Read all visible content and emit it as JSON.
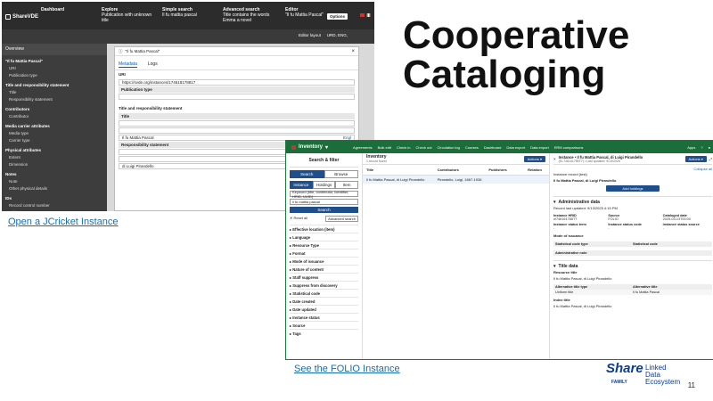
{
  "slide": {
    "title_line1": "Cooperative",
    "title_line2": "Cataloging",
    "link_jcricket": "Open a JCricket Instance",
    "link_folio": "See the FOLIO Instance",
    "page_number": "11",
    "logo": {
      "share": "Share",
      "family": "FAMILY",
      "line1": "Linked",
      "line2": "Data",
      "line3": "Ecosystem"
    }
  },
  "sharevde": {
    "app_name": "ShareVDE",
    "nav": [
      {
        "title": "Dashboard",
        "subtitle": ""
      },
      {
        "title": "Explore",
        "subtitle": "Publication with unknown title"
      },
      {
        "title": "Simple search",
        "subtitle": "Il fu mattia pascal"
      },
      {
        "title": "Advanced search",
        "subtitle": "Title contains the words Emma a novel"
      },
      {
        "title": "Editor",
        "subtitle": "\"Il fu Mattia Pascal\""
      }
    ],
    "options_label": "Options",
    "editor_layout": "Editor layout",
    "language": "URD, ENG,",
    "overview_label": "Overview",
    "overview_record": "\"Il fu Mattia Pascal\"",
    "sidebar": [
      {
        "label": "URI",
        "type": "sub"
      },
      {
        "label": "Publication type",
        "type": "sub"
      },
      {
        "label": "Title and responsibility statement",
        "type": "group"
      },
      {
        "label": "Title",
        "type": "sub"
      },
      {
        "label": "Responsibility statement",
        "type": "sub"
      },
      {
        "label": "Contributors",
        "type": "group"
      },
      {
        "label": "Contributor",
        "type": "sub"
      },
      {
        "label": "Media carrier attributes",
        "type": "group"
      },
      {
        "label": "Media type",
        "type": "sub"
      },
      {
        "label": "Carrier type",
        "type": "sub"
      },
      {
        "label": "Physical attributes",
        "type": "group"
      },
      {
        "label": "Extent",
        "type": "sub"
      },
      {
        "label": "Dimension",
        "type": "sub"
      },
      {
        "label": "Notes",
        "type": "group"
      },
      {
        "label": "Note",
        "type": "sub"
      },
      {
        "label": "Other physical details",
        "type": "sub"
      },
      {
        "label": "IDs",
        "type": "group"
      },
      {
        "label": "Record control number",
        "type": "sub"
      },
      {
        "label": "Add property",
        "type": "sub"
      }
    ],
    "editor": {
      "header": "\"Il fu Mattia Pascal\"",
      "tab_metadata": "Metadata",
      "tab_logs": "Logs",
      "uri_label": "URI",
      "uri_value": "https://svde.org/instances/174618178817",
      "pubtype_label": "Publication type",
      "title_section": "Title and responsibility statement",
      "title_label": "Title",
      "title_value": "Il fu Mattia Pascal",
      "resp_label": "Responsibility statement",
      "resp_value": "di Luigi Pirandello",
      "eng": "Engl"
    }
  },
  "folio": {
    "app_name": "Inventory",
    "nav": [
      "Agreements",
      "Bulk edit",
      "Check in",
      "Check out",
      "Circulation log",
      "Courses",
      "Dashboard",
      "Data export",
      "Data import",
      "ERM comparisons"
    ],
    "apps_label": "Apps",
    "filter": {
      "title": "Search & filter",
      "tab_search": "Search",
      "tab_browse": "Browse",
      "seg_instance": "Instance",
      "seg_holdings": "Holdings",
      "seg_item": "Item",
      "keyword_value": "Keyword (title, contributor, identifier, HRID, UUID)",
      "query_value": "il fu mattia pascal",
      "search_button": "Search",
      "reset_all": "Reset all",
      "advanced_search": "Advanced search",
      "facets": [
        "Effective location (item)",
        "Language",
        "Resource Type",
        "Format",
        "Mode of issuance",
        "Nature of content",
        "Staff suppress",
        "Suppress from discovery",
        "Statistical code",
        "Date created",
        "Date updated",
        "Instance status",
        "Source",
        "Tags"
      ]
    },
    "results": {
      "title": "Inventory",
      "count": "1 record found",
      "actions": "Actions",
      "col_title": "Title",
      "col_contrib": "Contributors",
      "col_pub": "Publishers",
      "col_rel": "Relation",
      "row_title": "Il fu Mattia Pascal, di Luigi Pirandello",
      "row_contrib": "Pirandello, Luigi, 1867-1936"
    },
    "detail": {
      "title": "Instance • Il fu Mattia Pascal, di Luigi Pirandello",
      "subtitle": "(EL746161785T7) • Last updated: 9/13/2025",
      "actions": "Actions",
      "collapse_all": "Collapse all",
      "record_label": "Instance record (test)",
      "instance_title": "Il fu Mattia Pascal, di Luigi Pirandello",
      "add_holdings": "Add holdings",
      "admin_section": "Administrative data",
      "record_updated": "Record last updated: 9/13/2025 4:15 PM",
      "grid": [
        {
          "label": "Instance HRID",
          "value": "el746161785T7"
        },
        {
          "label": "Source",
          "value": "FOLIO"
        },
        {
          "label": "Cataloged date",
          "value": "2025-03-13T00:00"
        },
        {
          "label": "Instance status term",
          "value": "-"
        },
        {
          "label": "Instance status code",
          "value": "-"
        },
        {
          "label": "Instance status source",
          "value": "-"
        }
      ],
      "mode_of_issuance": "Mode of issuance",
      "stat_code_type": "Statistical code type",
      "stat_code": "Statistical code",
      "admin_note": "Administrative note",
      "title_data_section": "Title data",
      "resource_title_label": "Resource title",
      "resource_title_value": "Il fu Mattia Pascal, di Luigi Pirandello",
      "alt_title_type": "Alternative title type",
      "alt_title": "Alternative title",
      "alt_row_type": "Uniform title",
      "alt_row_title": "Il fu Mattia Pascal",
      "index_title_label": "Index title",
      "index_title_value": "Il fu Mattia Pascal, di Luigi Pirandello"
    }
  }
}
